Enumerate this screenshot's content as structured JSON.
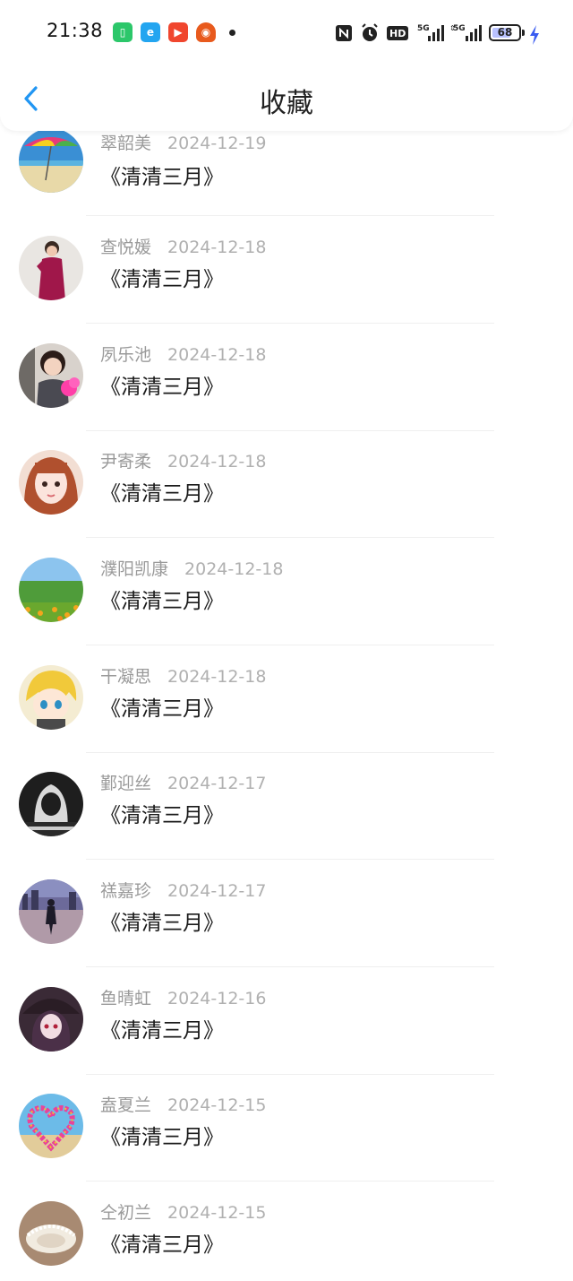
{
  "status_bar": {
    "time": "21:38",
    "battery": "68",
    "signal_1": "5G",
    "signal_2": "5G",
    "hd_badge": "HD",
    "app_icons": [
      "app-green-icon",
      "app-blue-icon",
      "video-red-icon",
      "app-orange-icon"
    ]
  },
  "header": {
    "title": "收藏",
    "back_icon": "chevron-left-icon"
  },
  "colors": {
    "accent": "#2196f3",
    "username": "#9a9a9a",
    "title_text": "#1a1a1a",
    "divider": "#efefef"
  },
  "favorites": [
    {
      "user": "翠韶美",
      "date": "2024-12-19",
      "title": "《清清三月》"
    },
    {
      "user": "查悦媛",
      "date": "2024-12-18",
      "title": "《清清三月》"
    },
    {
      "user": "夙乐池",
      "date": "2024-12-18",
      "title": "《清清三月》"
    },
    {
      "user": "尹寄柔",
      "date": "2024-12-18",
      "title": "《清清三月》"
    },
    {
      "user": "濮阳凯康",
      "date": "2024-12-18",
      "title": "《清清三月》"
    },
    {
      "user": "干凝思",
      "date": "2024-12-18",
      "title": "《清清三月》"
    },
    {
      "user": "鄞迎丝",
      "date": "2024-12-17",
      "title": "《清清三月》"
    },
    {
      "user": "禚嘉珍",
      "date": "2024-12-17",
      "title": "《清清三月》"
    },
    {
      "user": "鱼晴虹",
      "date": "2024-12-16",
      "title": "《清清三月》"
    },
    {
      "user": "盍夏兰",
      "date": "2024-12-15",
      "title": "《清清三月》"
    },
    {
      "user": "仝初兰",
      "date": "2024-12-15",
      "title": "《清清三月》"
    }
  ]
}
